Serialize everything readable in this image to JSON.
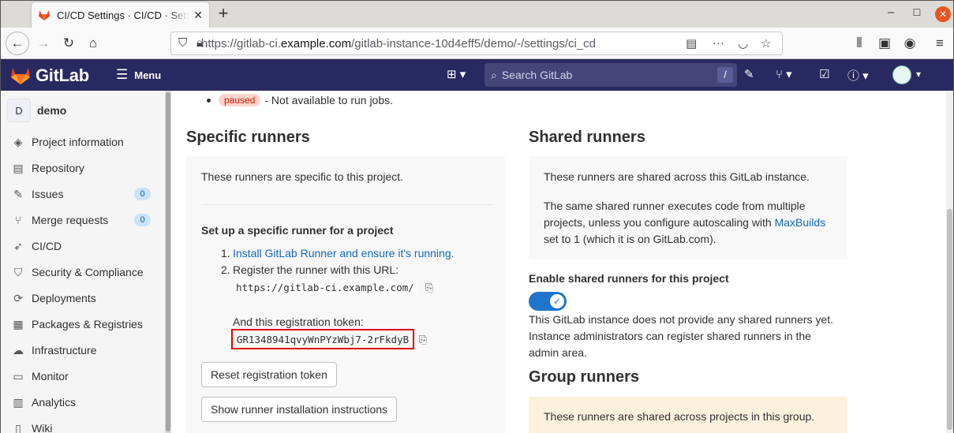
{
  "browser": {
    "tab_title": "CI/CD Settings · CI/CD · Settings",
    "url_prefix": "https://gitlab-ci.",
    "url_domain": "example.com",
    "url_path": "/gitlab-instance-10d4eff5/demo/-/settings/ci_cd"
  },
  "header": {
    "brand": "GitLab",
    "menu_label": "Menu",
    "search_placeholder": "Search GitLab",
    "search_shortcut": "/"
  },
  "sidebar": {
    "project_initial": "D",
    "project_name": "demo",
    "items": [
      {
        "label": "Project information"
      },
      {
        "label": "Repository"
      },
      {
        "label": "Issues",
        "badge": "0"
      },
      {
        "label": "Merge requests",
        "badge": "0"
      },
      {
        "label": "CI/CD"
      },
      {
        "label": "Security & Compliance"
      },
      {
        "label": "Deployments"
      },
      {
        "label": "Packages & Registries"
      },
      {
        "label": "Infrastructure"
      },
      {
        "label": "Monitor"
      },
      {
        "label": "Analytics"
      },
      {
        "label": "Wiki"
      }
    ]
  },
  "main": {
    "paused_badge": "paused",
    "paused_text": "- Not available to run jobs.",
    "specific": {
      "title": "Specific runners",
      "intro": "These runners are specific to this project.",
      "setup_title": "Set up a specific runner for a project",
      "step1_num": "1.",
      "step1_link": "Install GitLab Runner and ensure it's running.",
      "step2_num": "2.",
      "step2_text": "Register the runner with this URL:",
      "url": "https://gitlab-ci.example.com/",
      "token_label": "And this registration token:",
      "token": "GR1348941qvyWnPYzWbj7-2rFkdyB",
      "reset_button": "Reset registration token",
      "show_button": "Show runner installation instructions"
    },
    "shared": {
      "title": "Shared runners",
      "p1": "These runners are shared across this GitLab instance.",
      "p2_line1": "The same shared runner executes code from multiple",
      "p2_line2_pre": "projects, unless you configure autoscaling with ",
      "p2_link": "MaxBuilds",
      "p2_line3": "set to 1 (which it is on GitLab.com).",
      "enable_label": "Enable shared runners for this project",
      "toggle_on": true,
      "note_line1": "This GitLab instance does not provide any shared runners yet.",
      "note_line2": "Instance administrators can register shared runners in the",
      "note_line3": "admin area."
    },
    "group": {
      "title": "Group runners",
      "p1": "These runners are shared across projects in this group."
    }
  }
}
